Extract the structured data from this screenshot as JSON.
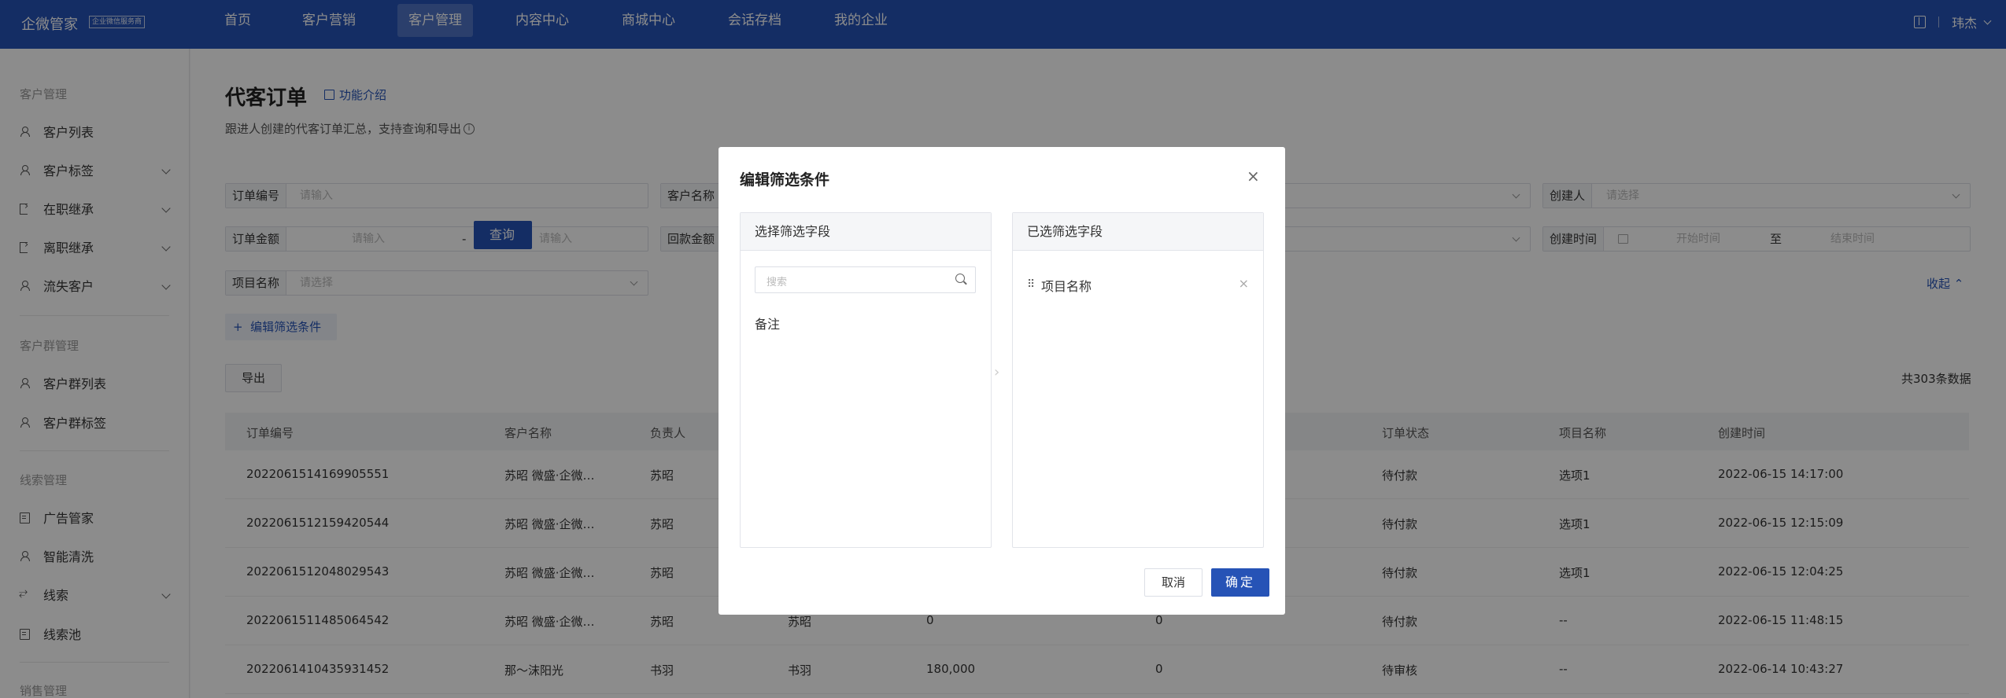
{
  "app": {
    "brand": "企微管家",
    "brand_badge": "企业微信服务商",
    "user_name": "玮杰"
  },
  "topnav": [
    "首页",
    "客户营销",
    "客户管理",
    "内容中心",
    "商城中心",
    "会话存档",
    "我的企业"
  ],
  "sidebar": {
    "groups": [
      "客户管理",
      "客户群管理",
      "线索管理",
      "销售管理"
    ],
    "items": [
      "客户列表",
      "客户标签",
      "在职继承",
      "离职继承",
      "流失客户",
      "客户群列表",
      "客户群标签",
      "广告管家",
      "智能清洗",
      "线索",
      "线索池"
    ]
  },
  "page": {
    "title": "代客订单",
    "intro_link": "功能介绍",
    "description": "跟进人创建的代客订单汇总，支持查询和导出",
    "info_glyph": "i"
  },
  "filters": {
    "order_no_label": "订单编号",
    "order_no_ph": "请输入",
    "customer_label": "客户名称",
    "creator_label": "创建人",
    "creator_ph": "请选择",
    "amount_label": "订单金额",
    "amount_min_ph": "请输入",
    "amount_sep": "-",
    "amount_max_ph": "请输入",
    "refund_label": "回款金额",
    "created_label": "创建时间",
    "start_ph": "开始时间",
    "range_sep": "至",
    "end_ph": "结束时间",
    "project_label": "项目名称",
    "project_ph": "请选择",
    "query_button": "查询",
    "collapse_link": "收起",
    "edit_filter_button": "编辑筛选条件",
    "plus_glyph": "+",
    "up_glyph": "⌃"
  },
  "toolbar": {
    "export_button": "导出",
    "total": "共303条数据"
  },
  "table": {
    "headers": [
      "订单编号",
      "客户名称",
      "负责人",
      "订单状态",
      "项目名称",
      "创建时间"
    ],
    "rows": [
      {
        "order_no": "2022061514169905551",
        "customer": "苏昭 微盛·企微…",
        "owner": "苏昭",
        "col4": "",
        "col5": "",
        "col6": "",
        "status": "待付款",
        "project": "选项1",
        "created": "2022-06-15 14:17:00"
      },
      {
        "order_no": "2022061512159420544",
        "customer": "苏昭 微盛·企微…",
        "owner": "苏昭",
        "col4": "",
        "col5": "",
        "col6": "",
        "status": "待付款",
        "project": "选项1",
        "created": "2022-06-15 12:15:09"
      },
      {
        "order_no": "2022061512048029543",
        "customer": "苏昭 微盛·企微…",
        "owner": "苏昭",
        "col4": "",
        "col5": "",
        "col6": "",
        "status": "待付款",
        "project": "选项1",
        "created": "2022-06-15 12:04:25"
      },
      {
        "order_no": "2022061511485064542",
        "customer": "苏昭 微盛·企微…",
        "owner": "苏昭",
        "col4": "苏昭",
        "col5": "0",
        "col6": "0",
        "status": "待付款",
        "project": "--",
        "created": "2022-06-15 11:48:15"
      },
      {
        "order_no": "2022061410435931452",
        "customer": "那～沫阳光",
        "owner": "书羽",
        "col4": "书羽",
        "col5": "180,000",
        "col6": "0",
        "status": "待审核",
        "project": "--",
        "created": "2022-06-14 10:43:27"
      }
    ]
  },
  "modal": {
    "title": "编辑筛选条件",
    "close_glyph": "×",
    "left_title": "选择筛选字段",
    "search_ph": "搜索",
    "available": [
      "备注"
    ],
    "arrow_glyph": "›",
    "right_title": "已选筛选字段",
    "selected": [
      "项目名称"
    ],
    "drag_glyph": "⠿",
    "remove_glyph": "×",
    "cancel": "取消",
    "confirm": "确定"
  }
}
